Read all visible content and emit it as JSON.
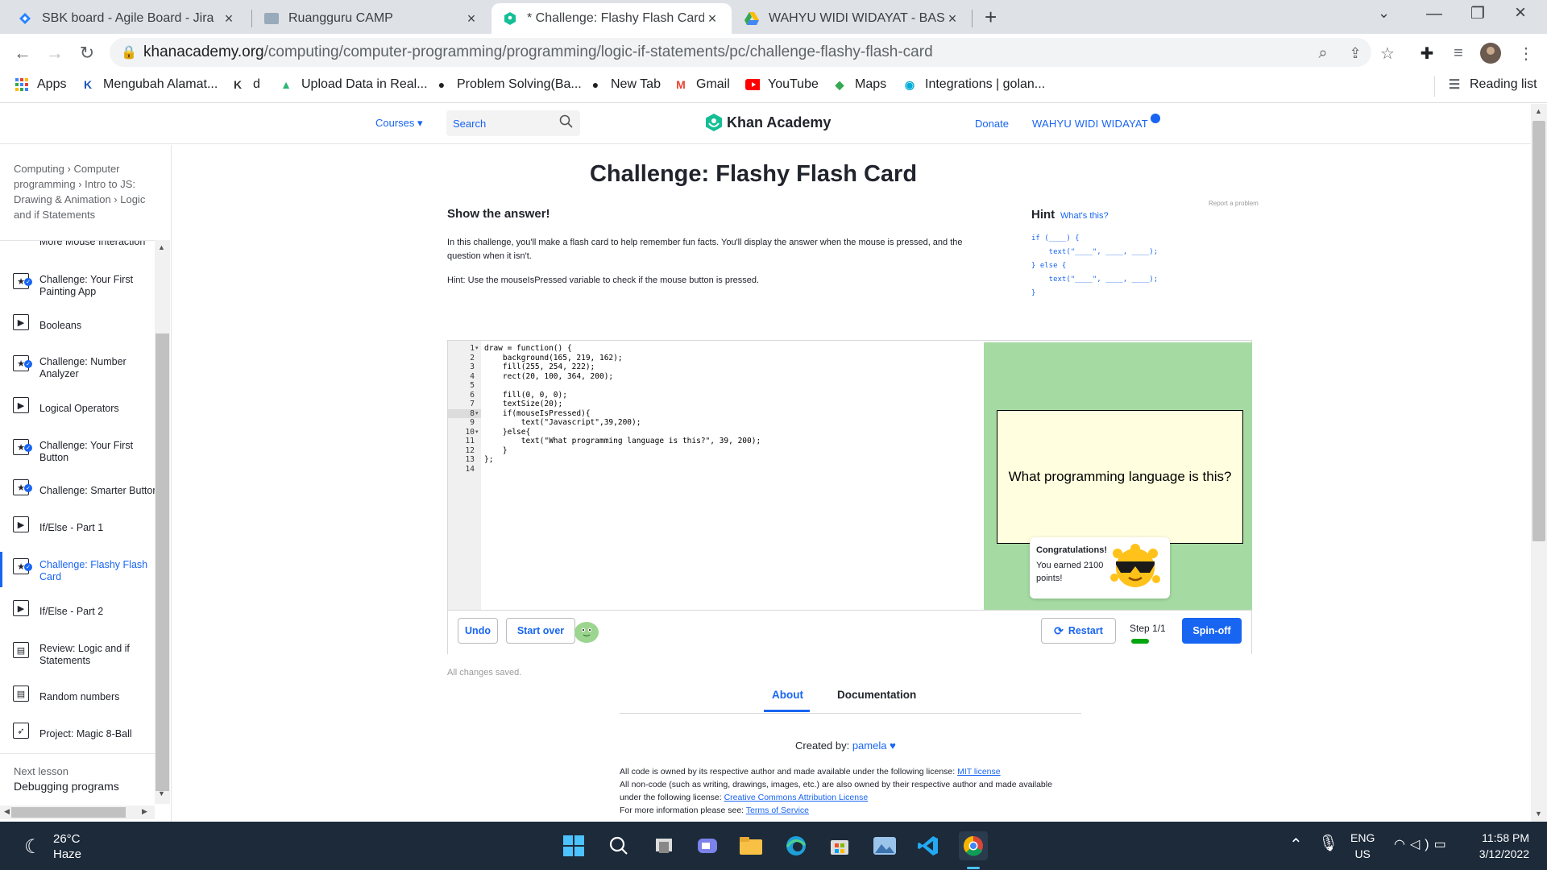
{
  "browser": {
    "tabs": [
      {
        "title": "SBK board - Agile Board - Jira",
        "active": false
      },
      {
        "title": "Ruangguru CAMP",
        "active": false
      },
      {
        "title": "* Challenge: Flashy Flash Card | Lo",
        "active": true
      },
      {
        "title": "WAHYU WIDI WIDAYAT - BASIC P",
        "active": false
      }
    ],
    "new_tab": "+",
    "url_host": "khanacademy.org",
    "url_path": "/computing/computer-programming/programming/logic-if-statements/pc/challenge-flashy-flash-card",
    "bookmarks": [
      {
        "label": "Apps",
        "icon": "apps-grid-icon"
      },
      {
        "label": "Mengubah Alamat...",
        "icon": "kodular-icon"
      },
      {
        "label": "d",
        "icon": "k-icon"
      },
      {
        "label": "Upload Data in Real...",
        "icon": "upload-icon"
      },
      {
        "label": "Problem Solving(Ba...",
        "icon": "github-icon"
      },
      {
        "label": "New Tab",
        "icon": "github-icon"
      },
      {
        "label": "Gmail",
        "icon": "gmail-icon"
      },
      {
        "label": "YouTube",
        "icon": "youtube-icon"
      },
      {
        "label": "Maps",
        "icon": "maps-icon"
      },
      {
        "label": "Integrations | golan...",
        "icon": "integrations-icon"
      }
    ],
    "reading_list": "Reading list"
  },
  "header": {
    "courses": "Courses",
    "search_placeholder": "Search",
    "logo": "Khan Academy",
    "donate": "Donate",
    "username": "WAHYU WIDI WIDAYAT"
  },
  "sidebar": {
    "breadcrumb": [
      "Computing",
      "Computer programming",
      "Intro to JS: Drawing & Animation",
      "Logic and if Statements"
    ],
    "partial_item": "More Mouse Interaction",
    "items": [
      {
        "label": "Challenge: Your First Painting App",
        "type": "challenge",
        "done": true
      },
      {
        "label": "Booleans",
        "type": "video",
        "done": false
      },
      {
        "label": "Challenge: Number Analyzer",
        "type": "challenge",
        "done": true
      },
      {
        "label": "Logical Operators",
        "type": "video",
        "done": false
      },
      {
        "label": "Challenge: Your First Button",
        "type": "challenge",
        "done": true
      },
      {
        "label": "Challenge: Smarter Button",
        "type": "challenge",
        "done": true
      },
      {
        "label": "If/Else - Part 1",
        "type": "video",
        "done": false
      },
      {
        "label": "Challenge: Flashy Flash Card",
        "type": "challenge",
        "done": true,
        "active": true
      },
      {
        "label": "If/Else - Part 2",
        "type": "video",
        "done": false
      },
      {
        "label": "Review: Logic and if Statements",
        "type": "article",
        "done": false
      },
      {
        "label": "Random numbers",
        "type": "article",
        "done": false
      },
      {
        "label": "Project: Magic 8-Ball",
        "type": "project",
        "done": false
      }
    ],
    "next_lesson_label": "Next lesson",
    "next_lesson": "Debugging programs"
  },
  "main": {
    "title": "Challenge: Flashy Flash Card",
    "step_title": "Show the answer!",
    "description": "In this challenge, you'll make a flash card to help remember fun facts. You'll display the answer when the mouse is pressed, and the question when it isn't.",
    "hint_text": "Hint: Use the mouseIsPressed variable to check if the mouse button is pressed.",
    "report": "Report a problem",
    "hint_label": "Hint",
    "whats_this": "What's this?",
    "hint_code": "if (____) {\n    text(\"____\", ____, ____);\n} else {\n    text(\"____\", ____, ____);\n}"
  },
  "editor": {
    "lines": [
      "draw = function() {",
      "    background(165, 219, 162);",
      "    fill(255, 254, 222);",
      "    rect(20, 100, 364, 200);",
      "",
      "    fill(0, 0, 0);",
      "    textSize(20);",
      "    if(mouseIsPressed){",
      "        text(\"Javascript\",39,200);",
      "    }else{",
      "        text(\"What programming language is this?\", 39, 200);",
      "    }",
      "};",
      ""
    ],
    "line_numbers": [
      "1",
      "2",
      "3",
      "4",
      "5",
      "6",
      "7",
      "8",
      "9",
      "10",
      "11",
      "12",
      "13",
      "14"
    ],
    "fold_markers": {
      "1": "▾",
      "8": "▾",
      "10": "▾"
    },
    "canvas_text": "What programming language is this?",
    "congrats_title": "Congratulations!",
    "congrats_body": "You earned 2100 points!",
    "undo": "Undo",
    "start_over": "Start over",
    "restart": "Restart",
    "step": "Step 1/1",
    "spinoff": "Spin-off",
    "saved": "All changes saved."
  },
  "info": {
    "tab_about": "About",
    "tab_docs": "Documentation",
    "created_by_label": "Created by:",
    "author": "pamela",
    "license_line1_pre": "All code is owned by its respective author and made available under the following license:",
    "license_line1_link": "MIT license",
    "license_line2_pre": "All non-code (such as writing, drawings, images, etc.) are also owned by their respective author and made available under the following license:",
    "license_line2_link": "Creative Commons Attribution License",
    "license_line3_pre": "For more information please see:",
    "license_line3_link": "Terms of Service"
  },
  "taskbar": {
    "temp": "26°C",
    "condition": "Haze",
    "lang1": "ENG",
    "lang2": "US",
    "time": "11:58 PM",
    "date": "3/12/2022"
  },
  "colors": {
    "accent": "#1865f2",
    "canvas_bg": "#a5dba2",
    "card_bg": "#fffede",
    "progress": "#00a60e"
  }
}
